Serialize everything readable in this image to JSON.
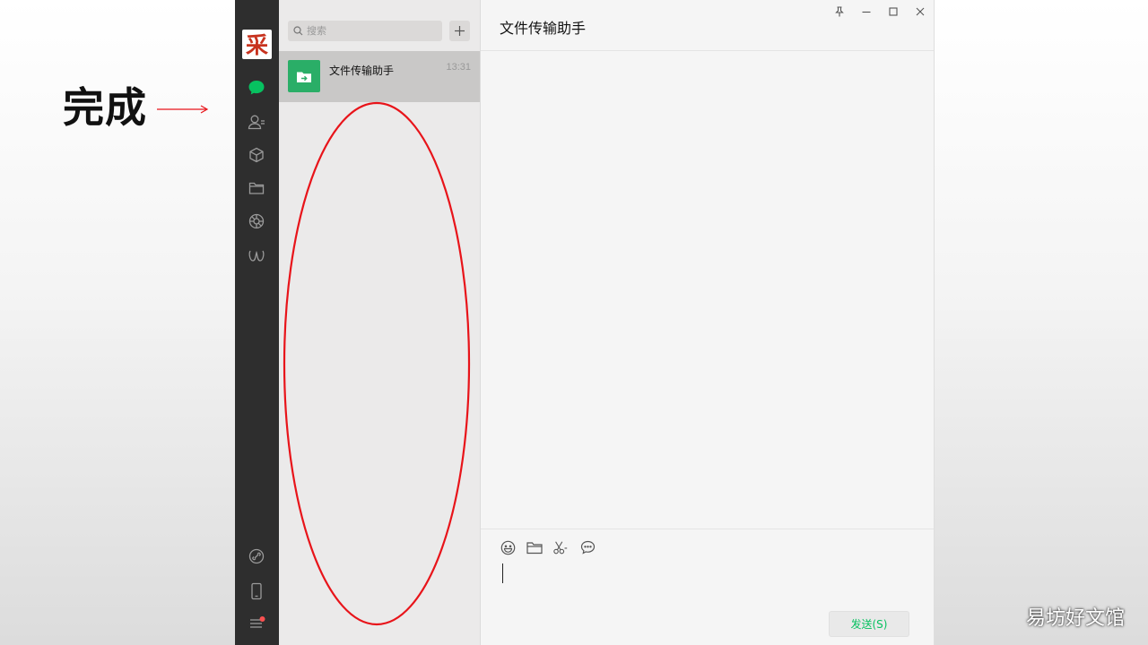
{
  "annotation": {
    "label": "完成"
  },
  "watermark": {
    "text": "易坊好文馆"
  },
  "sidebar": {
    "avatar_char": "采",
    "icons": [
      "chat-icon",
      "contacts-icon",
      "favorites-icon",
      "files-icon",
      "moments-icon",
      "mini-programs-icon",
      "link-icon",
      "phone-icon",
      "menu-icon"
    ],
    "active_color": "#07c160"
  },
  "search": {
    "placeholder": "搜索",
    "value": ""
  },
  "chat_list": [
    {
      "name": "文件传输助手",
      "time": "13:31",
      "avatar_icon": "file-transfer-icon",
      "avatar_color": "#2aae67"
    }
  ],
  "main": {
    "title": "文件传输助手",
    "toolbar_icons": [
      "emoji-icon",
      "folder-icon",
      "scissors-icon",
      "chat-history-icon"
    ],
    "send_label": "发送(S)"
  },
  "colors": {
    "highlight_ellipse": "#e8141a",
    "accent": "#07c160"
  }
}
